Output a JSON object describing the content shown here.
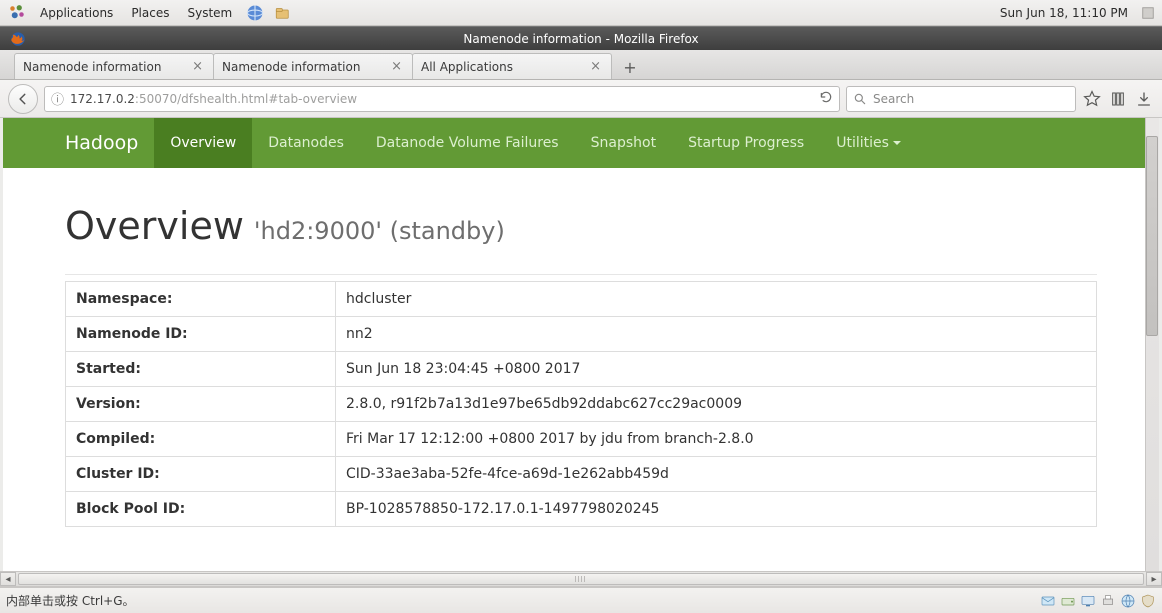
{
  "gnome": {
    "menus": [
      "Applications",
      "Places",
      "System"
    ],
    "clock": "Sun Jun 18, 11:10 PM"
  },
  "firefox": {
    "title": "Namenode information - Mozilla Firefox",
    "tabs": [
      {
        "label": "Namenode information"
      },
      {
        "label": "Namenode information"
      },
      {
        "label": "All Applications"
      }
    ],
    "url_host": "172.17.0.2",
    "url_rest": ":50070/dfshealth.html#tab-overview",
    "search_placeholder": "Search"
  },
  "hadoop": {
    "brand": "Hadoop",
    "nav": [
      "Overview",
      "Datanodes",
      "Datanode Volume Failures",
      "Snapshot",
      "Startup Progress",
      "Utilities"
    ],
    "heading": "Overview",
    "subhead": "'hd2:9000' (standby)",
    "rows": [
      {
        "k": "Namespace:",
        "v": "hdcluster"
      },
      {
        "k": "Namenode ID:",
        "v": "nn2"
      },
      {
        "k": "Started:",
        "v": "Sun Jun 18 23:04:45 +0800 2017"
      },
      {
        "k": "Version:",
        "v": "2.8.0, r91f2b7a13d1e97be65db92ddabc627cc29ac0009"
      },
      {
        "k": "Compiled:",
        "v": "Fri Mar 17 12:12:00 +0800 2017 by jdu from branch-2.8.0"
      },
      {
        "k": "Cluster ID:",
        "v": "CID-33ae3aba-52fe-4fce-a69d-1e262abb459d"
      },
      {
        "k": "Block Pool ID:",
        "v": "BP-1028578850-172.17.0.1-1497798020245"
      }
    ]
  },
  "statusbar": {
    "text": "内部单击或按 Ctrl+G。"
  }
}
